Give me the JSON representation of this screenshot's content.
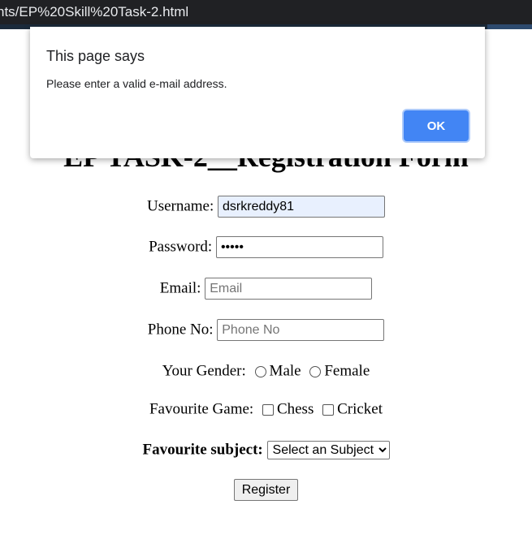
{
  "browser": {
    "url_fragment": "nts/EP%20Skill%20Task-2.html"
  },
  "page": {
    "title": "EP TASK-2__Registration Form"
  },
  "form": {
    "username": {
      "label": "Username:",
      "value": "dsrkreddy81"
    },
    "password": {
      "label": "Password:",
      "value": "•••••"
    },
    "email": {
      "label": "Email:",
      "placeholder": "Email"
    },
    "phone": {
      "label": "Phone No:",
      "placeholder": "Phone No"
    },
    "gender": {
      "label": "Your Gender:",
      "options": [
        "Male",
        "Female"
      ]
    },
    "game": {
      "label": "Favourite Game:",
      "options": [
        "Chess",
        "Cricket"
      ]
    },
    "subject": {
      "label": "Favourite subject:",
      "selected": "Select an Subject"
    },
    "register_label": "Register"
  },
  "dialog": {
    "title": "This page says",
    "message": "Please enter a valid e-mail address.",
    "ok_label": "OK"
  }
}
